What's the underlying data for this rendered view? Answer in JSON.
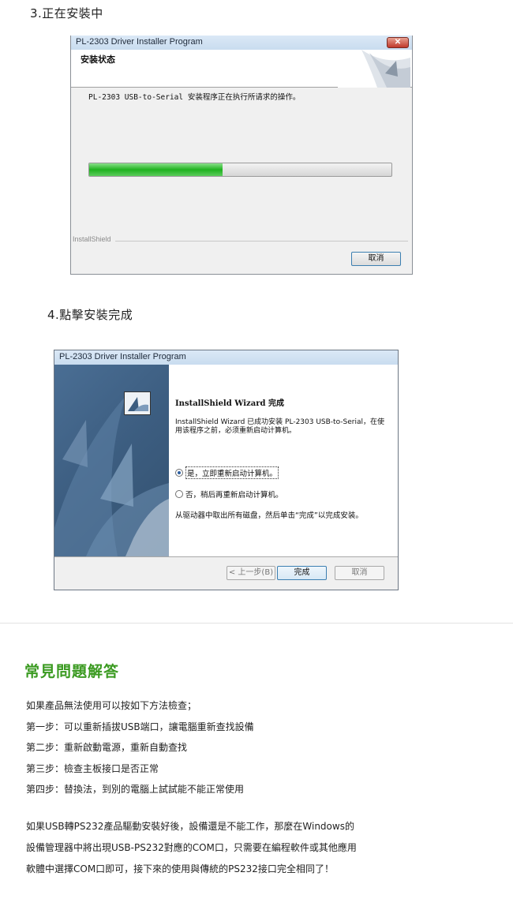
{
  "step3": {
    "heading": "3.正在安裝中"
  },
  "dialog1": {
    "title": "PL-2303 Driver Installer Program",
    "close_label": "✕",
    "header_title": "安装状态",
    "message": "PL-2303 USB-to-Serial 安装程序正在执行所请求的操作。",
    "progress": 0.44,
    "brand": "InstallShield",
    "cancel_label": "取消"
  },
  "step4": {
    "heading": "4.點擊安裝完成"
  },
  "dialog2": {
    "title": "PL-2303 Driver Installer Program",
    "wizard_title": "InstallShield Wizard 完成",
    "message": "InstallShield Wizard 已成功安装 PL-2303 USB-to-Serial，在使用该程序之前，必须重新启动计算机。",
    "option_restart_now": "是，立即重新启动计算机。",
    "option_restart_later": "否，稍后再重新启动计算机。",
    "note": "从驱动器中取出所有磁盘，然后单击“完成”以完成安装。",
    "back_label": "< 上一步(B)",
    "finish_label": "完成",
    "cancel_label": "取消"
  },
  "faq": {
    "title": "常見問題解答",
    "lines": [
      "如果產品無法使用可以按如下方法檢查；",
      "第一步：可以重新插拔USB端口，讓電腦重新查找設備",
      "第二步：重新啟動電源，重新自動查找",
      "第三步：檢查主板接口是否正常",
      "第四步：替換法，到別的電腦上試試能不能正常使用"
    ],
    "paragraph": [
      "如果USB轉PS232產品驅動安裝好後，設備還是不能工作，那麼在Windows的",
      "設備管理器中將出現USB-PS232對應的COM口，只需要在編程軟件或其他應用",
      "軟體中選擇COM口即可，接下來的使用與傳統的PS232接口完全相同了！"
    ]
  },
  "colors": {
    "accent_green": "#3a9a20",
    "progress_green": "#1fb21f",
    "wizard_side": "#3c5d80"
  }
}
